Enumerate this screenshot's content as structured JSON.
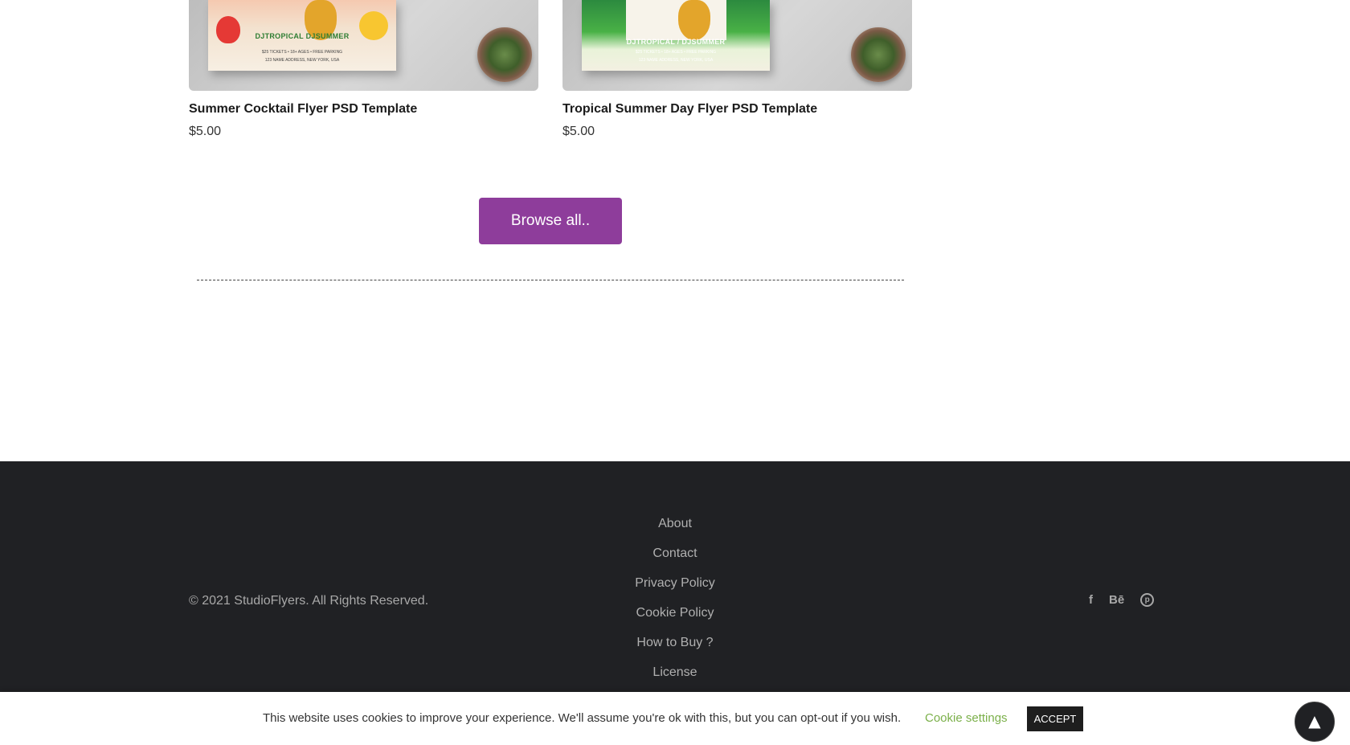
{
  "products": [
    {
      "title": "Summer Cocktail Flyer PSD Template",
      "price": "$5.00",
      "flyer_text": {
        "headline": "DJTROPICAL  DJSUMMER",
        "line1": "$25 TICKETS • 18+ AGES • FREE PARKING",
        "line2": "123 NAME ADDRESS, NEW YORK, USA"
      }
    },
    {
      "title": "Tropical Summer Day Flyer PSD Template",
      "price": "$5.00",
      "flyer_text": {
        "headline": "DJTROPICAL / DJSUMMER",
        "line1": "$25 TICKETS • 18+ AGES • FREE PARKING",
        "line2": "123 NAME ADDRESS, NEW YORK, USA"
      }
    }
  ],
  "browse_label": "Browse all..",
  "footer": {
    "copyright": "© 2021 StudioFlyers. All Rights Reserved.",
    "nav": [
      "About",
      "Contact",
      "Privacy Policy",
      "Cookie Policy",
      "How to Buy ?",
      "License"
    ],
    "social": {
      "facebook": "f",
      "behance": "Bē",
      "pinterest": "p"
    }
  },
  "cookie_bar": {
    "text": "This website uses cookies to improve your experience. We'll assume you're ok with this, but you can opt-out if you wish.",
    "settings_label": "Cookie settings",
    "accept_label": "ACCEPT"
  },
  "back_to_top_icon": "▲",
  "colors": {
    "accent": "#8e3d9b",
    "footer_bg": "#202124",
    "cookie_link": "#7bb04a"
  }
}
